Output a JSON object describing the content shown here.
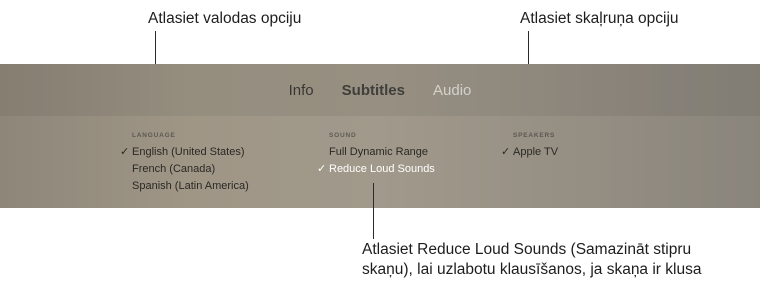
{
  "callouts": {
    "language": "Atlasiet valodas opciju",
    "speakers": "Atlasiet skaļruņa opciju",
    "sound": "Atlasiet Reduce Loud Sounds (Samazināt stipru skaņu), lai uzlabotu klausīšanos, ja skaņa ir klusa"
  },
  "tabs": [
    {
      "label": "Info"
    },
    {
      "label": "Subtitles"
    },
    {
      "label": "Audio",
      "active": true
    }
  ],
  "language": {
    "header": "LANGUAGE",
    "options": [
      {
        "label": "English (United States)",
        "check": "✓"
      },
      {
        "label": "French (Canada)",
        "check": ""
      },
      {
        "label": "Spanish (Latin America)",
        "check": ""
      }
    ]
  },
  "sound": {
    "header": "SOUND",
    "options": [
      {
        "label": "Full Dynamic Range",
        "check": ""
      },
      {
        "label": "Reduce Loud Sounds",
        "check": "✓"
      }
    ]
  },
  "speakers": {
    "header": "SPEAKERS",
    "options": [
      {
        "label": "Apple TV",
        "check": "✓"
      }
    ]
  }
}
